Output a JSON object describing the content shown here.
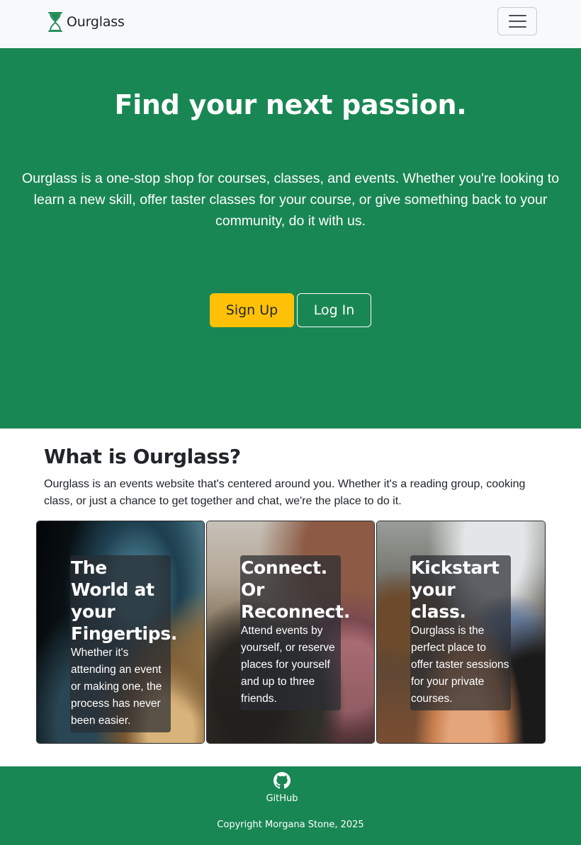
{
  "navbar": {
    "brand_name": "Ourglass",
    "logo_icon": "hourglass-icon",
    "menu_icon": "hamburger-menu-icon"
  },
  "hero": {
    "title": "Find your next passion.",
    "description": "Ourglass is a one-stop shop for courses, classes, and events. Whether you're looking to learn a new skill, offer taster classes for your course, or give something back to your community, do it with us.",
    "signup_label": "Sign Up",
    "login_label": "Log In"
  },
  "about": {
    "title": "What is Ourglass?",
    "description": "Ourglass is an events website that's centered around you. Whether it's a reading group, cooking class, or just a chance to get together and chat, we're the place to do it."
  },
  "cards": [
    {
      "title": "The World at your Fingertips.",
      "text": "Whether it's attending an event or making one, the process has never been easier."
    },
    {
      "title": "Connect. Or Reconnect.",
      "text": "Attend events by yourself, or reserve places for yourself and up to three friends."
    },
    {
      "title": "Kickstart your class.",
      "text": "Ourglass is the perfect place to offer taster sessions for your private courses."
    }
  ],
  "footer": {
    "github_label": "GitHub",
    "github_icon": "github-icon",
    "copyright": "Copyright Morgana Stone, 2025"
  },
  "colors": {
    "primary_green": "#198754",
    "warning_yellow": "#ffc107",
    "navbar_bg": "#f8f9fa"
  }
}
